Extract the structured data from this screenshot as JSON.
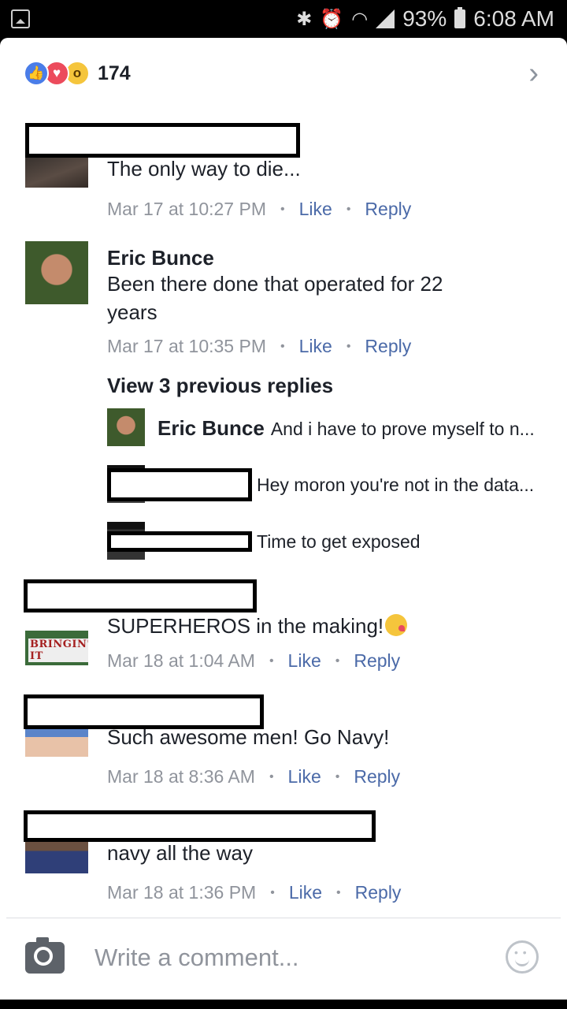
{
  "status_bar": {
    "battery": "93%",
    "time": "6:08 AM",
    "icons": [
      "image-icon",
      "bluetooth-icon",
      "alarm-icon",
      "wifi-icon",
      "signal-icon",
      "battery-icon"
    ]
  },
  "reactions": {
    "count": "174",
    "types": [
      "like",
      "love",
      "wow"
    ]
  },
  "comments": [
    {
      "author": "",
      "text": "The only way to die...",
      "time": "Mar 17 at 10:27 PM",
      "like_label": "Like",
      "reply_label": "Reply"
    },
    {
      "author": "Eric Bunce",
      "text": "Been there done that operated for 22 years",
      "time": "Mar 17 at 10:35 PM",
      "like_label": "Like",
      "reply_label": "Reply",
      "view_previous": "View 3 previous replies",
      "replies": [
        {
          "author": "Eric Bunce",
          "text": "And i have to prove myself to n..."
        },
        {
          "author": "",
          "text": "Hey moron you're not in the data..."
        },
        {
          "author": "",
          "text": "Time to get exposed"
        }
      ]
    },
    {
      "author": "",
      "avatar_caption": "BRINGIN' IT",
      "text": "SUPERHEROS in the making!",
      "time": "Mar 18 at 1:04 AM",
      "like_label": "Like",
      "reply_label": "Reply"
    },
    {
      "author": "",
      "text": "Such awesome men!  Go Navy!",
      "time": "Mar 18 at 8:36 AM",
      "like_label": "Like",
      "reply_label": "Reply"
    },
    {
      "author": "",
      "text": "navy all the way",
      "time": "Mar 18 at 1:36 PM",
      "like_label": "Like",
      "reply_label": "Reply"
    }
  ],
  "composer": {
    "placeholder": "Write a comment..."
  },
  "colors": {
    "link": "#4b6aa8",
    "meta": "#90949c",
    "text": "#1d2129",
    "like_reaction": "#4a7de8",
    "love_reaction": "#ec4b5c",
    "wow_reaction": "#f5c53c"
  }
}
